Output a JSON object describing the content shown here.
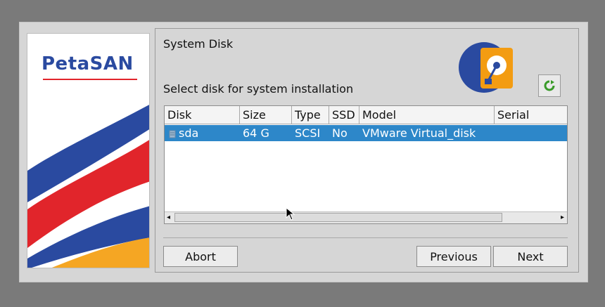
{
  "brand": {
    "logo_text_a": "Peta",
    "logo_text_b": "SAN"
  },
  "page": {
    "title": "System Disk",
    "subtitle": "Select disk for system installation"
  },
  "table": {
    "columns": [
      "Disk",
      "Size",
      "Type",
      "SSD",
      "Model",
      "Serial"
    ],
    "rows": [
      {
        "disk": "sda",
        "size": "64 G",
        "type": "SCSI",
        "ssd": "No",
        "model": "VMware Virtual_disk",
        "serial": ""
      }
    ]
  },
  "buttons": {
    "abort": "Abort",
    "previous": "Previous",
    "next": "Next"
  },
  "icons": {
    "refresh": "refresh-icon",
    "disk": "hard-disk-icon",
    "row_disk": "drive-icon"
  },
  "colors": {
    "selection": "#2d87c9",
    "brand_blue": "#2a4aa0",
    "brand_red": "#e1252b",
    "brand_orange": "#f5a623"
  }
}
